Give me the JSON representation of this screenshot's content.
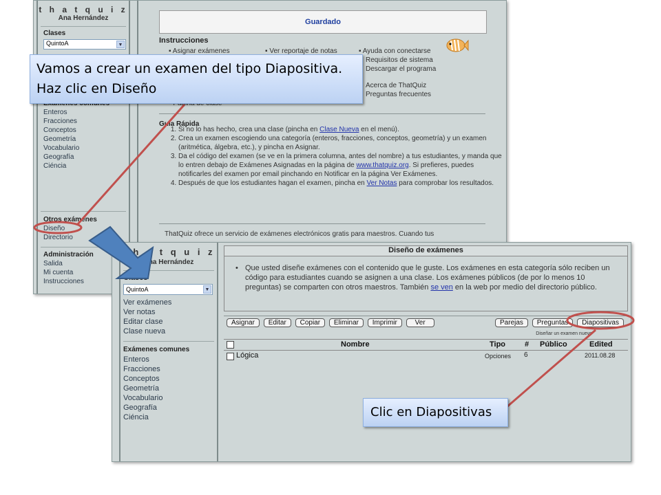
{
  "back": {
    "logo": "t h a t q u i z",
    "user": "Ana Hernández",
    "classes_title": "Clases",
    "class_selected": "QuintoA",
    "common_title": "Exámenes comunes",
    "common_items": [
      "Enteros",
      "Fracciones",
      "Conceptos",
      "Geometría",
      "Vocabulario",
      "Geografía",
      "Ciéncia"
    ],
    "others_title": "Otros exámenes",
    "others_items": [
      "Diseño",
      "Directorio"
    ],
    "admin_title": "Administración",
    "admin_items": [
      "Salida",
      "Mi cuenta",
      "Instrucciones"
    ],
    "saved_banner": "Guardado",
    "instructions_title": "Instrucciones",
    "instr_col1": [
      "Asignar exámenes",
      "Página de clase"
    ],
    "instr_col2": [
      "Ver reportaje de notas"
    ],
    "instr_col3": [
      "Ayuda con conectarse",
      "Requisitos de sistema",
      "Descargar el programa",
      "Acerca de ThatQuiz",
      "Preguntas frecuentes"
    ],
    "quick_title": "Guía Rápida",
    "quick_steps": [
      {
        "pre": "Si no lo has hecho, crea una clase (pincha en ",
        "link": "Clase Nueva",
        "post": " en el menú)."
      },
      {
        "pre": "Crea un examen escogiendo una categoría (enteros, fracciones, conceptos, geometría) y un examen (aritmética, álgebra, etc.), y pincha en Asignar.",
        "link": "",
        "post": ""
      },
      {
        "pre": "Da el código del examen (se ve en la primera columna, antes del nombre) a tus estudiantes, y manda que lo entren debajo de Exámenes Asignadas en la página de ",
        "link": "www.thatquiz.org",
        "post": ". Si prefieres, puedes notificarles del examen por email pinchando en Notificar en la página Ver Exámenes."
      },
      {
        "pre": "Después de que los estudiantes hagan el examen, pincha en ",
        "link": "Ver Notas",
        "post": " para comprobar los resultados."
      }
    ],
    "footer_text": "ThatQuiz ofrece un servicio de exámenes electrónicos gratis para maestros. Cuando tus"
  },
  "front": {
    "logo": "t h a t q u i z",
    "user": "Ana Hernández",
    "classes_title": "Clases",
    "class_selected": "QuintoA",
    "class_links": [
      "Ver exámenes",
      "Ver notas",
      "Editar clase",
      "Clase nueva"
    ],
    "common_title": "Exámenes comunes",
    "common_items": [
      "Enteros",
      "Fracciones",
      "Conceptos",
      "Geometría",
      "Vocabulario",
      "Geografía",
      "Ciéncia"
    ],
    "panel_title": "Diseño de exámenes",
    "panel_text_pre": "Que usted diseñe exámenes con el contenido que le guste. Los exámenes en esta categoría sólo reciben un código para estudiantes cuando se asignen a una clase. Los exámenes públicos (de por lo menos 10 preguntas) se comparten con otros maestros. También ",
    "panel_link": "se ven",
    "panel_text_post": " en la web por medio del directorio público.",
    "buttons_left": [
      "Asignar",
      "Editar",
      "Copiar",
      "Eliminar",
      "Imprimir",
      "Ver"
    ],
    "buttons_right": [
      "Parejas",
      "Preguntas",
      "Diapositivas"
    ],
    "hint": "Diseñar un examen nuevo",
    "table_headers": [
      "Nombre",
      "Tipo",
      "#",
      "Público",
      "Edited"
    ],
    "rows": [
      {
        "name": "Lógica",
        "tipo": "Opciones",
        "count": "6",
        "publico": "",
        "edited": "2011.08.28"
      }
    ]
  },
  "callouts": {
    "top_line1": "Vamos a crear un examen del tipo Diapositiva.",
    "top_line2": "Haz clic en Diseño",
    "bottom": "Clic en Diapositivas"
  },
  "colors": {
    "annotation_red": "#c0504d",
    "arrow_blue": "#4f81bd",
    "link_blue": "#2233aa"
  }
}
